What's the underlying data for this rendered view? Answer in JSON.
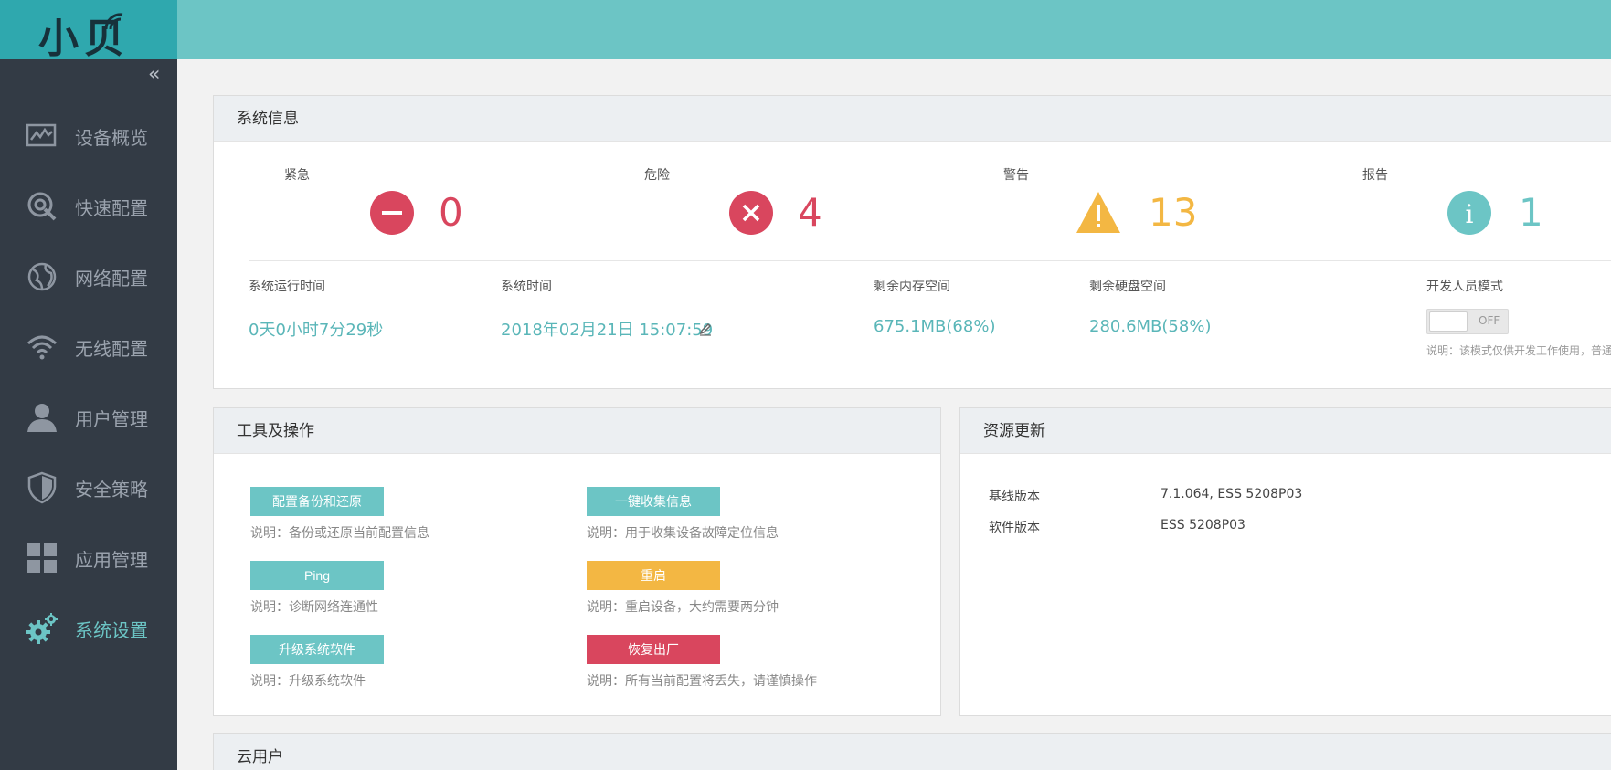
{
  "brand": {
    "logo_text": "小贝"
  },
  "sidebar": {
    "collapse_glyph": "«",
    "items": [
      {
        "label": "设备概览",
        "icon": "dashboard-icon"
      },
      {
        "label": "快速配置",
        "icon": "quick-config-icon"
      },
      {
        "label": "网络配置",
        "icon": "globe-icon"
      },
      {
        "label": "无线配置",
        "icon": "wifi-icon"
      },
      {
        "label": "用户管理",
        "icon": "user-icon"
      },
      {
        "label": "安全策略",
        "icon": "shield-icon"
      },
      {
        "label": "应用管理",
        "icon": "apps-grid-icon"
      },
      {
        "label": "系统设置",
        "icon": "gears-icon",
        "active": true
      }
    ]
  },
  "system_info": {
    "title": "系统信息",
    "alerts": [
      {
        "label": "紧急",
        "count": "0",
        "icon": "minus-circle-icon",
        "color": "#d9465e"
      },
      {
        "label": "危险",
        "count": "4",
        "icon": "x-circle-icon",
        "color": "#d9465e"
      },
      {
        "label": "警告",
        "count": "13",
        "icon": "warning-triangle-icon",
        "color": "#f3b743"
      },
      {
        "label": "报告",
        "count": "1",
        "icon": "info-circle-icon",
        "color": "#6cc5c5"
      }
    ],
    "uptime_label": "系统运行时间",
    "uptime_value": "0天0小时7分29秒",
    "time_label": "系统时间",
    "time_value": "2018年02月21日 15:07:59",
    "memory_label": "剩余内存空间",
    "memory_value": "675.1MB(68%)",
    "disk_label": "剩余硬盘空间",
    "disk_value": "280.6MB(58%)",
    "dev_mode_label": "开发人员模式",
    "dev_mode_toggle": "OFF",
    "dev_mode_note": "说明：该模式仅供开发工作使用，普通"
  },
  "tools": {
    "title": "工具及操作",
    "buttons": [
      {
        "label": "配置备份和还原",
        "note": "说明：备份或还原当前配置信息",
        "color": "#6cc5c5"
      },
      {
        "label": "一键收集信息",
        "note": "说明：用于收集设备故障定位信息",
        "color": "#6cc5c5"
      },
      {
        "label": "Ping",
        "note": "说明：诊断网络连通性",
        "color": "#6cc5c5"
      },
      {
        "label": "重启",
        "note": "说明：重启设备，大约需要两分钟",
        "color": "#f3b743"
      },
      {
        "label": "升级系统软件",
        "note": "说明：升级系统软件",
        "color": "#6cc5c5"
      },
      {
        "label": "恢复出厂",
        "note": "说明：所有当前配置将丢失，请谨慎操作",
        "color": "#d9465e"
      }
    ]
  },
  "resources": {
    "title": "资源更新",
    "baseline_label": "基线版本",
    "baseline_value": "7.1.064, ESS 5208P03",
    "software_label": "软件版本",
    "software_value": "ESS 5208P03"
  },
  "cloud_user": {
    "title": "云用户"
  }
}
